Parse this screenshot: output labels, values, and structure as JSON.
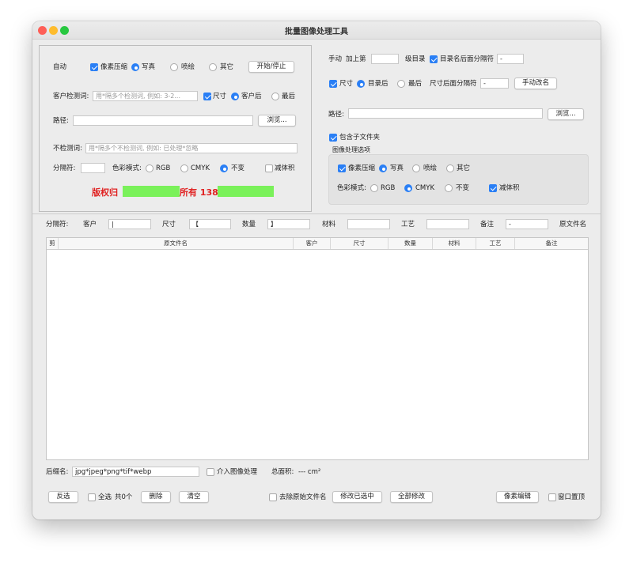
{
  "window": {
    "title": "批量图像处理工具"
  },
  "colors": {
    "accent": "#2a7ff5",
    "copyright": "#e02020",
    "highlight": "#7af15a",
    "close": "#fe5f57",
    "minimize": "#febc2e",
    "zoom": "#28c840"
  },
  "auto": {
    "label": "自动",
    "pixel_compress": "像素压缩",
    "mode_photo": "写真",
    "mode_spray": "喷绘",
    "mode_other": "其它",
    "start_stop": "开始/停止",
    "customer_keywords_label": "客户检测词:",
    "customer_keywords_placeholder": "用*隔多个检测词, 例如: 3-2...",
    "size": "尺寸",
    "pos_after_customer": "客户后",
    "pos_last": "最后",
    "path_label": "路径:",
    "browse": "浏览...",
    "exclude_label": "不检测词:",
    "exclude_placeholder": "用*隔多个不检测词, 例如: 已处理*忽略",
    "separator_label": "分隔符:",
    "separator_value": "",
    "color_mode_label": "色彩模式:",
    "rgb": "RGB",
    "cmyk": "CMYK",
    "unchanged": "不变",
    "reduce_volume": "减体积",
    "copyright_a": "版权归",
    "copyright_b": "所有 1381"
  },
  "manual": {
    "label": "手动",
    "add_level": "加上第",
    "level_value": "",
    "level_dir": "级目录",
    "dir_sep": "目录名后面分隔符",
    "dir_sep_value": "-",
    "size": "尺寸",
    "pos_after_dir": "目录后",
    "pos_last": "最后",
    "size_sep": "尺寸后面分隔符",
    "size_sep_value": "-",
    "rename_button": "手动改名",
    "path_label": "路径:",
    "browse": "浏览...",
    "include_sub": "包含子文件夹",
    "image_options_title": "图像处理选项",
    "pixel_compress": "像素压缩",
    "mode_photo": "写真",
    "mode_spray": "喷绘",
    "mode_other": "其它",
    "color_mode_label": "色彩模式:",
    "rgb": "RGB",
    "cmyk": "CMYK",
    "unchanged": "不变",
    "reduce_volume": "减体积"
  },
  "sepbar": {
    "label": "分隔符:",
    "customer": "客户",
    "customer_value": "|",
    "size": "尺寸",
    "size_value": "【",
    "quantity": "数量",
    "quantity_value": "】",
    "material": "材料",
    "material_value": "",
    "craft": "工艺",
    "craft_value": "",
    "note": "备注",
    "note_value": "-",
    "original": "原文件名"
  },
  "table": {
    "columns": [
      "剪",
      "原文件名",
      "客户",
      "尺寸",
      "数量",
      "材料",
      "工艺",
      "备注"
    ],
    "rows": []
  },
  "footer": {
    "suffix_label": "后缀名:",
    "suffix_value": "jpg*jpeg*png*tif*webp",
    "include_image": "介入图像处理",
    "total_area_label": "总面积:",
    "total_area_value": "--- cm²",
    "invert": "反选",
    "select_all": "全选",
    "count": "共0个",
    "delete": "删除",
    "clear": "清空",
    "remove_original": "去除原始文件名",
    "modify_selected": "修改已选中",
    "modify_all": "全部修改",
    "pixel_edit": "像素编辑",
    "window_top": "窗口置顶"
  }
}
